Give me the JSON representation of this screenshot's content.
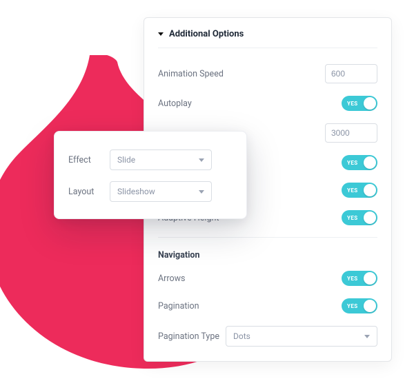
{
  "main": {
    "section_title": "Additional Options",
    "animation_speed": {
      "label": "Animation Speed",
      "value": "600"
    },
    "autoplay": {
      "label": "Autoplay",
      "state": "YES"
    },
    "autoplay_delay_value": "3000",
    "toggle_state": "YES",
    "adaptive_height": {
      "label": "Adaptive Height",
      "state": "YES"
    },
    "navigation": {
      "header": "Navigation",
      "arrows": {
        "label": "Arrows",
        "state": "YES"
      },
      "pagination": {
        "label": "Pagination",
        "state": "YES"
      },
      "pagination_type": {
        "label": "Pagination Type",
        "value": "Dots"
      }
    }
  },
  "float": {
    "effect": {
      "label": "Effect",
      "value": "Slide"
    },
    "layout": {
      "label": "Layout",
      "value": "Slideshow"
    }
  },
  "colors": {
    "accent_toggle": "#3cc9d6",
    "bg_shape": "#ed2b5b"
  }
}
